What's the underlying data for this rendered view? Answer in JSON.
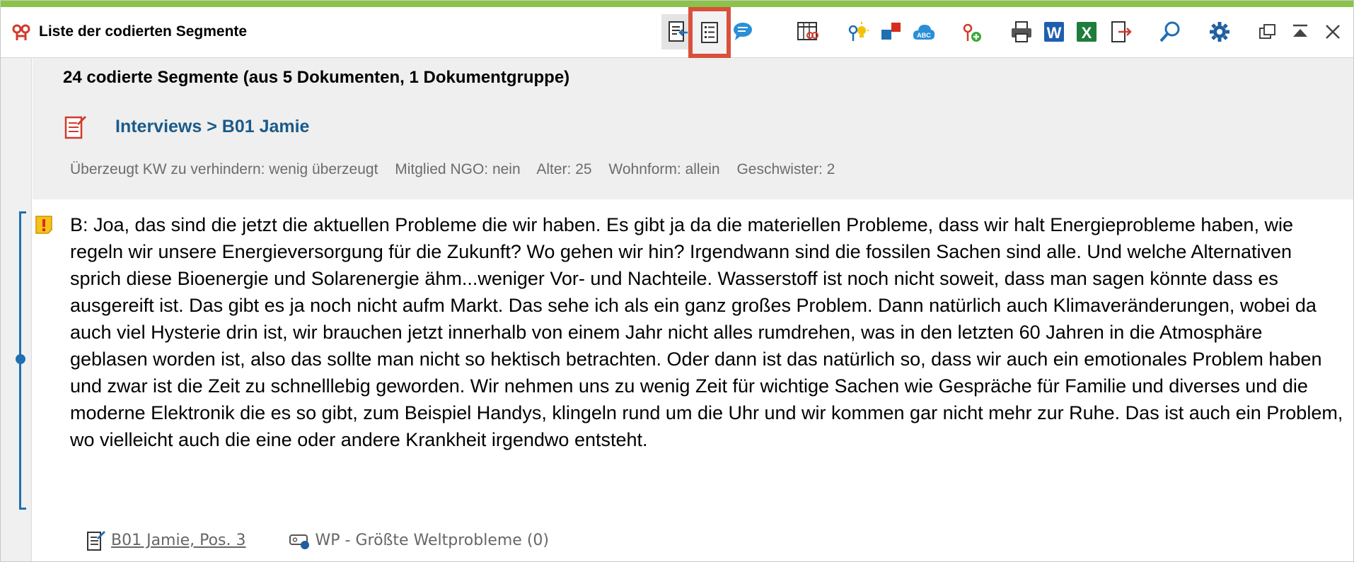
{
  "window": {
    "title": "Liste der codierten Segmente"
  },
  "toolbar": {
    "buttons": [
      {
        "name": "export-document-icon",
        "pressed": true
      },
      {
        "name": "list-view-icon",
        "highlighted": true
      },
      {
        "name": "comment-icon"
      },
      {
        "name": "matrix-codes-icon"
      },
      {
        "name": "idea-codes-icon"
      },
      {
        "name": "color-codes-icon"
      },
      {
        "name": "word-cloud-icon"
      },
      {
        "name": "add-code-icon"
      },
      {
        "name": "print-icon"
      },
      {
        "name": "word-export-icon"
      },
      {
        "name": "excel-export-icon"
      },
      {
        "name": "export-icon"
      },
      {
        "name": "search-icon"
      },
      {
        "name": "settings-icon"
      },
      {
        "name": "undock-window-icon"
      },
      {
        "name": "collapse-icon"
      },
      {
        "name": "close-icon"
      }
    ],
    "colors": {
      "accent": "#8bc34a",
      "highlight": "#d9503b",
      "link": "#1a5a8a"
    }
  },
  "summary": {
    "text": "24 codierte Segmente (aus 5 Dokumenten, 1 Dokumentgruppe)"
  },
  "document": {
    "path": "Interviews > B01 Jamie",
    "variables": [
      "Überzeugt KW zu verhindern: wenig überzeugt",
      "Mitglied NGO: nein",
      "Alter: 25",
      "Wohnform: allein",
      "Geschwister: 2"
    ]
  },
  "segment": {
    "text": "B: Joa, das sind die jetzt die aktuellen Probleme die wir haben. Es gibt ja da die materiellen Probleme, dass wir halt Energieprobleme haben, wie regeln wir unsere Energieversorgung für die Zukunft? Wo gehen wir hin? Irgendwann sind die fossilen Sachen sind alle. Und welche Alternativen sprich diese Bioenergie und Solarenergie ähm...weniger Vor- und Nachteile. Wasserstoff ist noch nicht soweit, dass man sagen könnte dass es ausgereift ist. Das gibt es ja noch nicht aufm Markt. Das sehe ich als ein ganz großes Problem. Dann natürlich auch Klimaveränderungen, wobei da auch viel Hysterie drin ist, wir brauchen jetzt innerhalb von einem Jahr nicht alles rumdrehen, was in den letzten 60 Jahren in die Atmosphäre geblasen worden ist, also das sollte man nicht so hektisch betrachten. Oder dann ist das natürlich so, dass wir auch ein emotionales Problem haben und zwar ist die Zeit zu schnelllebig geworden. Wir nehmen uns zu wenig Zeit für wichtige Sachen wie Gespräche für Familie und diverses und die moderne Elektronik die es so gibt, zum Beispiel Handys, klingeln rund um die Uhr und wir kommen gar nicht mehr zur Ruhe. Das ist auch ein Problem, wo vielleicht auch die eine oder andere Krankheit irgendwo entsteht.",
    "source_link": "B01 Jamie, Pos. 3",
    "code_label": "WP - Größte Weltprobleme (0)"
  }
}
